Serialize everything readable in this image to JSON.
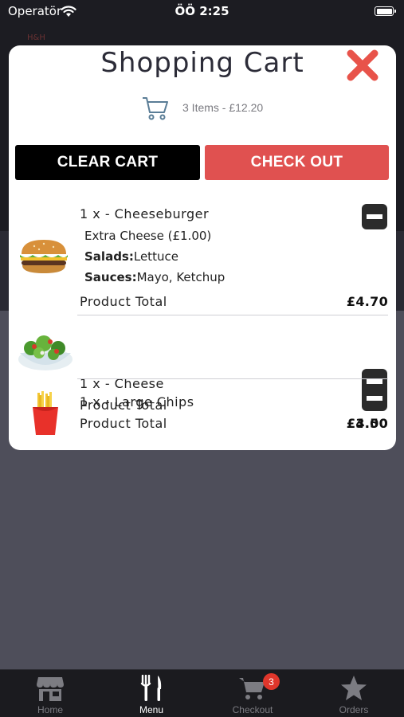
{
  "status_bar": {
    "carrier": "Operatör",
    "time": "ÖÖ 2:25"
  },
  "backdrop": {
    "logo_text": "H&H"
  },
  "cart": {
    "title": "Shopping Cart",
    "summary": "3 Items - £12.20",
    "clear_label": "CLEAR CART",
    "checkout_label": "CHECK OUT",
    "items": [
      {
        "name": "1 x - Cheeseburger",
        "extra": "Extra Cheese (£1.00)",
        "salads_label": "Salads:",
        "salads": "Lettuce",
        "sauces_label": "Sauces:",
        "sauces": "Mayo, Ketchup",
        "total_label": "Product Total",
        "price": "£4.70",
        "image": "burger-image"
      },
      {
        "name": "1 x - Cheese",
        "total_label": "Product Total",
        "price": "£3.50",
        "image": "salad-image"
      },
      {
        "name": "1 x - Large Chips",
        "total_label": "Product Total",
        "price": "£4.00",
        "image": "chips-image"
      }
    ]
  },
  "tab_bar": {
    "tabs": [
      {
        "label": "Home",
        "icon": "store-icon",
        "active": false
      },
      {
        "label": "Menu",
        "icon": "cutlery-icon",
        "active": true
      },
      {
        "label": "Checkout",
        "icon": "cart-icon",
        "active": false,
        "badge": "3"
      },
      {
        "label": "Orders",
        "icon": "star-icon",
        "active": false
      }
    ]
  },
  "colors": {
    "accent_red": "#e05150",
    "close_red": "#e8534a",
    "badge_red": "#e0362b"
  }
}
